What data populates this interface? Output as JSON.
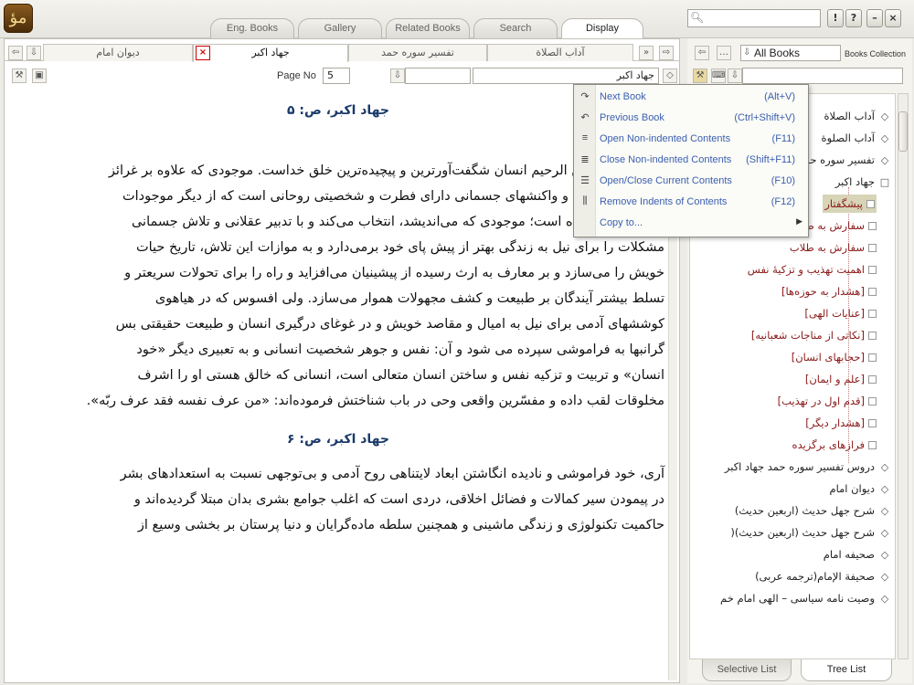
{
  "logo_text": "مؤ",
  "tabs": [
    "Eng. Books",
    "Gallery",
    "Related Books",
    "Search",
    "Display"
  ],
  "window_buttons": [
    "!",
    "?",
    "–",
    "×"
  ],
  "doc_tabs": [
    "دیوان امام",
    "جهاد اکبر",
    "تفسیر سوره حمد",
    "آداب الصلاة"
  ],
  "nav": {
    "page_label": "Page No",
    "page_value": "5",
    "jump_value": "جهاد اکبر"
  },
  "document": {
    "heading1": "جهاد اکبر، ص: ۵",
    "lines1": [
      "بسم الله الرحمن الرحیم انسان  شگفت‌آورترین و پیچیده‌ترین خلق خداست. موجودی که علاوه بر غرائز",
      "و تمایلات حیوانی و واکنشهای جسمانی دارای فطرت و  شخصیتی روحانی است که از دیگر موجودات",
      "زنده ممتاز گردیده است؛ موجودی که می‌اندیشد، انتخاب می‌کند و با تدبیر عقلانی و تلاش جسمانی",
      "مشکلات را برای نیل به زندگی بهتر از پیش پای خود برمی‌دارد و به موازات این تلاش، تاریخ حیات",
      "خویش را می‌سازد و بر معارف به ارث رسیده از پیشینیان می‌افزاید و راه را برای تحولات سریعتر و",
      "تسلط بیشتر آیندگان بر طبیعت و کشف مجهولات هموار می‌سازد. ولی افسوس که در هیاهوی",
      "کوششهای آدمی برای نیل به امیال و مقاصد خویش و در غوغای درگیری انسان و طبیعت حقیقتی بس",
      "گرانبها به فراموشی سپرده می شود و آن: نفس و جوهر  شخصیت انسانی و به تعبیری دیگر «خود",
      "انسان» و تربیت و تزکیه نفس و ساختن انسان متعالی است، انسانی که خالق هستی او را اشرف",
      "مخلوقات لقب داده و مفسّرین واقعی وحی در باب  شناختش فرموده‌اند: «من عرف نفسه فقد عرف ربّه»."
    ],
    "heading2": "جهاد اکبر، ص: ۶",
    "lines2": [
      "آری، خود فراموشی و نادیده انگاشتن ابعاد لایتناهی روح آدمی و بی‌توجهی نسبت به استعدادهای بشر",
      "در پیمودن سیر کمالات و فضائل اخلاقی، دردی است که اغلب جوامع بشری بدان مبتلا گردیده‌اند و",
      "حاکمیت تکنولوژی و زندگی ماشینی و همچنین سلطه ماده‌گرایان و دنیا پرستان بر بخشی وسیع از"
    ]
  },
  "right_panel": {
    "selector_value": "All Books",
    "collection_label": "Books Collection"
  },
  "tree": {
    "top_items": [
      "آداب الصلاة",
      "آداب الصلوة",
      "تفسیر سوره حمد",
      "جهاد اکبر"
    ],
    "sub_items": [
      "پیشگفتار",
      "سفارش به طلاب",
      "سفارش به طلاب",
      "اهمیت تهذیب و تزکیهٔ نفس",
      "[هشدار به حوزه‌ها]",
      "[عنایات الهی]",
      "[نکاتی از مناجات شعبانیه]",
      "[حجابهای انسان]",
      "[علم و ایمان]",
      "[قدم اول در تهذیب]",
      "[هشدار دیگر]",
      "فرازهای برگزیده"
    ],
    "bottom_items": [
      "دروس تفسیر سوره حمد جهاد اکبر",
      "دیوان امام",
      "شرح جهل حدیث (اربعین حدیث)",
      "شرح جهل حدیث (اربعین حدیث)(",
      "صحیفه امام",
      "صحیفة الإمام(ترجمه عربی)",
      "وصیت نامه سیاسی – الهی امام خم"
    ]
  },
  "bottom_tabs": [
    "Selective List",
    "Tree List"
  ],
  "context_menu": [
    {
      "label": "Next Book",
      "shortcut": "(Alt+V)",
      "icon": "book-next-icon"
    },
    {
      "label": "Previous Book",
      "shortcut": "(Ctrl+Shift+V)",
      "icon": "book-prev-icon"
    },
    {
      "label": "Open Non-indented Contents",
      "shortcut": "(F11)",
      "icon": "list-open-icon"
    },
    {
      "label": "Close Non-indented Contents",
      "shortcut": "(Shift+F11)",
      "icon": "list-close-icon"
    },
    {
      "label": "Open/Close Current Contents",
      "shortcut": "(F10)",
      "icon": "toggle-contents-icon"
    },
    {
      "label": "Remove Indents of Contents",
      "shortcut": "(F12)",
      "icon": "remove-indent-icon"
    },
    {
      "label": "Copy to...",
      "shortcut": "",
      "icon": "copy-icon"
    }
  ],
  "colors": {
    "link_blue": "#3a5fb0",
    "tree_sub": "#8a1a1a",
    "heading": "#1a3a6a"
  }
}
